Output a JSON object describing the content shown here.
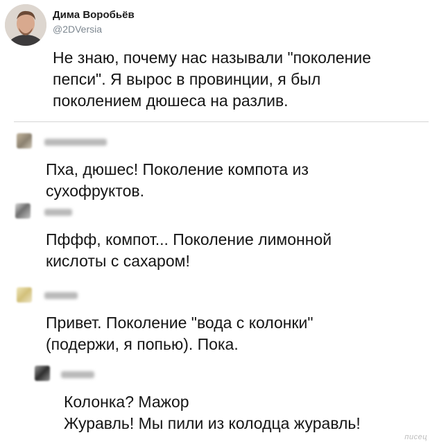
{
  "post": {
    "author_name": "Дима Воробьёв",
    "author_handle": "@2DVersia",
    "text": "Не знаю, почему нас называли \"поколение\nпепси\". Я вырос в провинции, я был\nпоколением дюшеса на разлив."
  },
  "replies": [
    {
      "text": "Пха, дюшес! Поколение компота из\nсухофруктов."
    },
    {
      "text": "Пффф, компот... Поколение лимонной\nкислоты с сахаром!"
    },
    {
      "text": "Привет. Поколение \"вода с колонки\"\n(подержи, я попью). Пока."
    },
    {
      "text": "Колонка? Мажор\nЖуравль! Мы пили из колодца журавль!"
    }
  ],
  "watermark": "писец",
  "colors": {
    "text": "#151515",
    "handle": "#7d8790",
    "divider": "#d6d6d6"
  }
}
